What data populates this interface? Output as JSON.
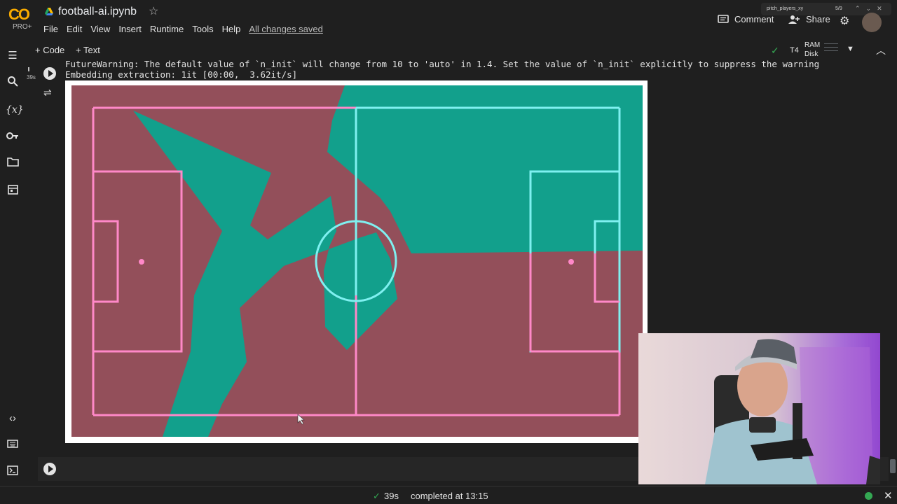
{
  "header": {
    "logo_text": "CO",
    "logo_badge": "PRO+",
    "title": "football-ai.ipynb",
    "menu": [
      "File",
      "Edit",
      "View",
      "Insert",
      "Runtime",
      "Tools",
      "Help"
    ],
    "saved_status": "All changes saved",
    "comment_label": "Comment",
    "share_label": "Share",
    "find_query": "pitch_players_xy",
    "find_count": "5/9"
  },
  "toolbar": {
    "code_label": "+ Code",
    "text_label": "+ Text",
    "runtime_type": "T4",
    "ram_label": "RAM",
    "disk_label": "Disk"
  },
  "cell": {
    "exec_time": "39s",
    "output_line_1": "FutureWarning: The default value of `n_init` will change from 10 to 'auto' in 1.4. Set the value of `n_init` explicitly to suppress the warning",
    "output_line_2": "Embedding extraction: 1it [00:00,  3.62it/s]"
  },
  "pitch": {
    "team_a_color": "#934f5a",
    "team_b_color": "#12a08c",
    "line_pink": "#ff88c8",
    "line_cyan": "#7ff0f0"
  },
  "statusbar": {
    "duration": "39s",
    "completed": "completed at 13:15"
  },
  "icons": {
    "sidebar": [
      "toc-icon",
      "search-icon",
      "variables-icon",
      "key-icon",
      "folder-icon",
      "calendar-icon",
      "code-snippets-icon",
      "command-palette-icon",
      "terminal-icon"
    ]
  }
}
